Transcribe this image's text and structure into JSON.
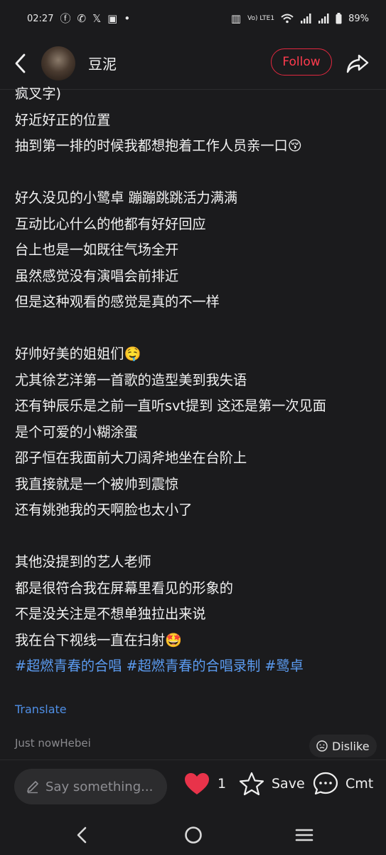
{
  "status": {
    "time": "02:27",
    "battery": "89%",
    "volte": "Vo) LTE1"
  },
  "header": {
    "author": "豆泥",
    "follow_label": "Follow"
  },
  "post": {
    "lines": [
      "疯叉字)",
      "好近好正的位置",
      "抽到第一排的时候我都想抱着工作人员亲一口😚",
      "",
      "好久没见的小鹭卓 蹦蹦跳跳活力满满",
      "互动比心什么的他都有好好回应",
      "台上也是一如既往气场全开",
      "虽然感觉没有演唱会前排近",
      "但是这种观看的感觉是真的不一样",
      "",
      "好帅好美的姐姐们🤤",
      "尤其徐艺洋第一首歌的造型美到我失语",
      "还有钟辰乐是之前一直听svt提到 这还是第一次见面",
      "是个可爱的小糊涂蛋",
      "邵子恒在我面前大刀阔斧地坐在台阶上",
      "我直接就是一个被帅到震惊",
      "还有姚弛我的天啊脸也太小了",
      "",
      "其他没提到的艺人老师",
      "都是很符合我在屏幕里看见的形象的",
      "不是没关注是不想单独拉出来说",
      "我在台下视线一直在扫射🤩"
    ],
    "hashtags": [
      "#超燃青春的合唱",
      "#超燃青春的合唱录制",
      "#鹭卓"
    ],
    "translate_label": "Translate",
    "meta": "Just nowHebei",
    "dislike_label": "Dislike"
  },
  "bottom": {
    "comment_placeholder": "Say something...",
    "like_count": "1",
    "save_label": "Save",
    "comment_label": "Cmt"
  },
  "colors": {
    "background": "#1b1b1d",
    "accent_red": "#ff3b4e",
    "hashtag_blue": "#5b9bf0",
    "heart": "#e8334a"
  }
}
